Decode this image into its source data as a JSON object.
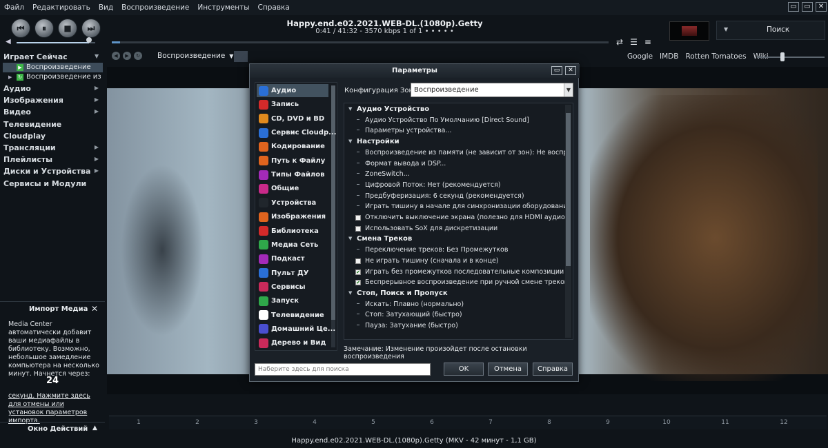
{
  "menu": [
    "Файл",
    "Редактировать",
    "Вид",
    "Воспроизведение",
    "Инструменты",
    "Справка"
  ],
  "window_controls": [
    "▭",
    "▭",
    "✕"
  ],
  "transport": {
    "prev": "⏮",
    "pause": "⏸",
    "stop": "■",
    "next": "⏭"
  },
  "volume_level": 0.92,
  "now_playing": {
    "title": "Happy.end.e02.2021.WEB-DL.(1080p).Getty",
    "info": "0:41 / 41:32 - 3570 kbps   1 of 1   • • • • •",
    "progress": 0.016
  },
  "search": {
    "label": "Поиск"
  },
  "sidebar": {
    "header": "Играет Сейчас",
    "sub_items": [
      {
        "label": "Воспроизведение",
        "selected": true
      },
      {
        "label": "Воспроизведение из Ма..."
      }
    ],
    "categories": [
      "Аудио",
      "Изображения",
      "Видео",
      "Телевидение",
      "Cloudplay",
      "Трансляции",
      "Плейлисты",
      "Диски и Устройства",
      "Сервисы и Модули"
    ]
  },
  "import": {
    "title": "Импорт Медиа",
    "close": "✕",
    "body": "Media Center автоматически добавит ваши медиафайлы в библиотеку. Возможно, небольшое замедление компьютера на несколько минут. Начнется через:",
    "countdown": "24",
    "link": "секунд. Нажмите здесь для отмены или установок параметров импорта."
  },
  "actions": {
    "label": "Окно Действий",
    "arrow": "▲"
  },
  "view": {
    "dropdown": "Воспроизведение"
  },
  "links": [
    "Google",
    "IMDB",
    "Rotten Tomatoes",
    "Wiki"
  ],
  "timeline": [
    "1",
    "2",
    "3",
    "4",
    "5",
    "6",
    "7",
    "8",
    "9",
    "10",
    "11",
    "12"
  ],
  "status": "Happy.end.e02.2021.WEB-DL.(1080p).Getty (MKV - 42 минут - 1,1 GB)",
  "dialog": {
    "title": "Параметры",
    "categories": [
      {
        "label": "Аудио",
        "color": "#2a6fd6",
        "selected": true
      },
      {
        "label": "Запись",
        "color": "#d42a2a"
      },
      {
        "label": "CD, DVD и BD",
        "color": "#e08a1e"
      },
      {
        "label": "Сервис Cloudp...",
        "color": "#2a6fd6"
      },
      {
        "label": "Кодирование",
        "color": "#e0641e"
      },
      {
        "label": "Путь к Файлу",
        "color": "#e0641e"
      },
      {
        "label": "Типы Файлов",
        "color": "#a32ab8"
      },
      {
        "label": "Общие",
        "color": "#c92a8a"
      },
      {
        "label": "Устройства",
        "color": "#20262c"
      },
      {
        "label": "Изображения",
        "color": "#e0641e"
      },
      {
        "label": "Библиотека",
        "color": "#d42a2a"
      },
      {
        "label": "Медиа Сеть",
        "color": "#2fa84a"
      },
      {
        "label": "Подкаст",
        "color": "#a32ab8"
      },
      {
        "label": "Пульт ДУ",
        "color": "#2a6fd6"
      },
      {
        "label": "Сервисы",
        "color": "#c92a5a"
      },
      {
        "label": "Запуск",
        "color": "#2fa84a"
      },
      {
        "label": "Телевидение",
        "color": "#ffffff"
      },
      {
        "label": "Домашний Це...",
        "color": "#4a4fd0"
      },
      {
        "label": "Дерево и Вид",
        "color": "#c92a5a"
      },
      {
        "label": "",
        "color": "#6a2ab8"
      }
    ],
    "zone_label": "Конфигурация Зоны:",
    "zone_value": "Воспроизведение",
    "tree": [
      {
        "type": "section",
        "label": "Аудио Устройство"
      },
      {
        "type": "item",
        "label": "Аудио Устройство По Умолчанию [Direct Sound]"
      },
      {
        "type": "item",
        "label": "Параметры устройства..."
      },
      {
        "type": "section",
        "label": "Настройки"
      },
      {
        "type": "item",
        "label": "Воспроизведение из памяти (не зависит от зон): Не воспроизвод..."
      },
      {
        "type": "item",
        "label": "Формат вывода и DSP..."
      },
      {
        "type": "item",
        "label": "ZoneSwitch..."
      },
      {
        "type": "item",
        "label": "Цифровой Поток: Нет (рекомендуется)"
      },
      {
        "type": "item",
        "label": "Предбуферизация: 6 секунд (рекомендуется)"
      },
      {
        "type": "item",
        "label": "Играть тишину в начале для синхронизации оборудования: Нет"
      },
      {
        "type": "check",
        "checked": false,
        "label": "Отключить выключение экрана (полезно для HDMI аудио)"
      },
      {
        "type": "check",
        "checked": false,
        "label": "Использовать SoX для дискретизации"
      },
      {
        "type": "section",
        "label": "Смена Треков"
      },
      {
        "type": "item",
        "label": "Переключение треков: Без Промежутков"
      },
      {
        "type": "check",
        "checked": false,
        "label": "Не играть тишину (сначала и в конце)"
      },
      {
        "type": "check",
        "checked": true,
        "label": "Играть без промежутков последовательные композиции альбо..."
      },
      {
        "type": "check",
        "checked": true,
        "label": "Беспрерывное воспроизведение при ручной смене треков"
      },
      {
        "type": "section",
        "label": "Стоп, Поиск и Пропуск"
      },
      {
        "type": "item",
        "label": "Искать: Плавно (нормально)"
      },
      {
        "type": "item",
        "label": "Стоп: Затухающий (быстро)"
      },
      {
        "type": "item",
        "label": "Пауза: Затухание (быстро)"
      }
    ],
    "note": "Замечание: Изменение произойдет после остановки воспроизведения",
    "search_placeholder": "Наберите здесь для поиска",
    "ok": "OK",
    "cancel": "Отмена",
    "help": "Справка"
  }
}
